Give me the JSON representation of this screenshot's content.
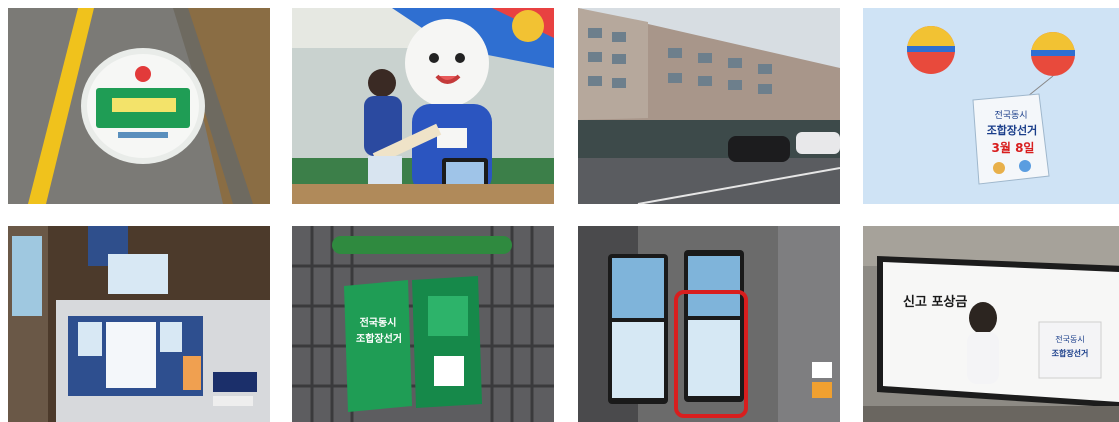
{
  "photos": [
    {
      "subject": "floor-sticker-on-path",
      "texts": []
    },
    {
      "subject": "mascot-at-store-counter",
      "texts": []
    },
    {
      "subject": "building-street-view",
      "texts": []
    },
    {
      "subject": "balloons-with-banner",
      "texts": [
        "전국동시",
        "조합장선거",
        "3월 8일"
      ]
    },
    {
      "subject": "kiosk-with-posters",
      "texts": []
    },
    {
      "subject": "shopping-cart-sign",
      "texts": [
        "전국동시",
        "조합장선거"
      ]
    },
    {
      "subject": "elevator-screens",
      "texts": []
    },
    {
      "subject": "subway-billboard",
      "texts": [
        "신고 포상금",
        "전국동시",
        "조합장선거"
      ]
    }
  ],
  "colors": {
    "highlight_box": "#d81e1e",
    "sign_green": "#1f9d55",
    "sky": "#cfe3f5"
  }
}
